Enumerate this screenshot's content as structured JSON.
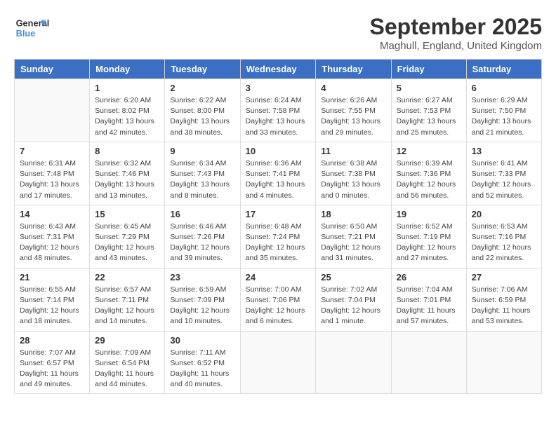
{
  "header": {
    "logo_line1": "General",
    "logo_line2": "Blue",
    "month": "September 2025",
    "location": "Maghull, England, United Kingdom"
  },
  "weekdays": [
    "Sunday",
    "Monday",
    "Tuesday",
    "Wednesday",
    "Thursday",
    "Friday",
    "Saturday"
  ],
  "weeks": [
    [
      {
        "day": "",
        "info": ""
      },
      {
        "day": "1",
        "info": "Sunrise: 6:20 AM\nSunset: 8:02 PM\nDaylight: 13 hours\nand 42 minutes."
      },
      {
        "day": "2",
        "info": "Sunrise: 6:22 AM\nSunset: 8:00 PM\nDaylight: 13 hours\nand 38 minutes."
      },
      {
        "day": "3",
        "info": "Sunrise: 6:24 AM\nSunset: 7:58 PM\nDaylight: 13 hours\nand 33 minutes."
      },
      {
        "day": "4",
        "info": "Sunrise: 6:26 AM\nSunset: 7:55 PM\nDaylight: 13 hours\nand 29 minutes."
      },
      {
        "day": "5",
        "info": "Sunrise: 6:27 AM\nSunset: 7:53 PM\nDaylight: 13 hours\nand 25 minutes."
      },
      {
        "day": "6",
        "info": "Sunrise: 6:29 AM\nSunset: 7:50 PM\nDaylight: 13 hours\nand 21 minutes."
      }
    ],
    [
      {
        "day": "7",
        "info": "Sunrise: 6:31 AM\nSunset: 7:48 PM\nDaylight: 13 hours\nand 17 minutes."
      },
      {
        "day": "8",
        "info": "Sunrise: 6:32 AM\nSunset: 7:46 PM\nDaylight: 13 hours\nand 13 minutes."
      },
      {
        "day": "9",
        "info": "Sunrise: 6:34 AM\nSunset: 7:43 PM\nDaylight: 13 hours\nand 8 minutes."
      },
      {
        "day": "10",
        "info": "Sunrise: 6:36 AM\nSunset: 7:41 PM\nDaylight: 13 hours\nand 4 minutes."
      },
      {
        "day": "11",
        "info": "Sunrise: 6:38 AM\nSunset: 7:38 PM\nDaylight: 13 hours\nand 0 minutes."
      },
      {
        "day": "12",
        "info": "Sunrise: 6:39 AM\nSunset: 7:36 PM\nDaylight: 12 hours\nand 56 minutes."
      },
      {
        "day": "13",
        "info": "Sunrise: 6:41 AM\nSunset: 7:33 PM\nDaylight: 12 hours\nand 52 minutes."
      }
    ],
    [
      {
        "day": "14",
        "info": "Sunrise: 6:43 AM\nSunset: 7:31 PM\nDaylight: 12 hours\nand 48 minutes."
      },
      {
        "day": "15",
        "info": "Sunrise: 6:45 AM\nSunset: 7:29 PM\nDaylight: 12 hours\nand 43 minutes."
      },
      {
        "day": "16",
        "info": "Sunrise: 6:46 AM\nSunset: 7:26 PM\nDaylight: 12 hours\nand 39 minutes."
      },
      {
        "day": "17",
        "info": "Sunrise: 6:48 AM\nSunset: 7:24 PM\nDaylight: 12 hours\nand 35 minutes."
      },
      {
        "day": "18",
        "info": "Sunrise: 6:50 AM\nSunset: 7:21 PM\nDaylight: 12 hours\nand 31 minutes."
      },
      {
        "day": "19",
        "info": "Sunrise: 6:52 AM\nSunset: 7:19 PM\nDaylight: 12 hours\nand 27 minutes."
      },
      {
        "day": "20",
        "info": "Sunrise: 6:53 AM\nSunset: 7:16 PM\nDaylight: 12 hours\nand 22 minutes."
      }
    ],
    [
      {
        "day": "21",
        "info": "Sunrise: 6:55 AM\nSunset: 7:14 PM\nDaylight: 12 hours\nand 18 minutes."
      },
      {
        "day": "22",
        "info": "Sunrise: 6:57 AM\nSunset: 7:11 PM\nDaylight: 12 hours\nand 14 minutes."
      },
      {
        "day": "23",
        "info": "Sunrise: 6:59 AM\nSunset: 7:09 PM\nDaylight: 12 hours\nand 10 minutes."
      },
      {
        "day": "24",
        "info": "Sunrise: 7:00 AM\nSunset: 7:06 PM\nDaylight: 12 hours\nand 6 minutes."
      },
      {
        "day": "25",
        "info": "Sunrise: 7:02 AM\nSunset: 7:04 PM\nDaylight: 12 hours\nand 1 minute."
      },
      {
        "day": "26",
        "info": "Sunrise: 7:04 AM\nSunset: 7:01 PM\nDaylight: 11 hours\nand 57 minutes."
      },
      {
        "day": "27",
        "info": "Sunrise: 7:06 AM\nSunset: 6:59 PM\nDaylight: 11 hours\nand 53 minutes."
      }
    ],
    [
      {
        "day": "28",
        "info": "Sunrise: 7:07 AM\nSunset: 6:57 PM\nDaylight: 11 hours\nand 49 minutes."
      },
      {
        "day": "29",
        "info": "Sunrise: 7:09 AM\nSunset: 6:54 PM\nDaylight: 11 hours\nand 44 minutes."
      },
      {
        "day": "30",
        "info": "Sunrise: 7:11 AM\nSunset: 6:52 PM\nDaylight: 11 hours\nand 40 minutes."
      },
      {
        "day": "",
        "info": ""
      },
      {
        "day": "",
        "info": ""
      },
      {
        "day": "",
        "info": ""
      },
      {
        "day": "",
        "info": ""
      }
    ]
  ]
}
